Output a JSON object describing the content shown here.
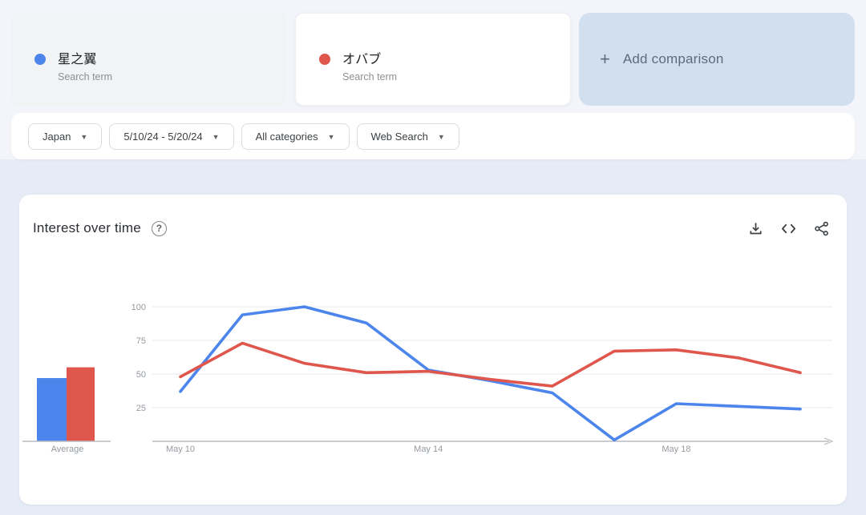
{
  "comparison_bar": {
    "terms": [
      {
        "label": "星之翼",
        "sublabel": "Search term",
        "color": "#4c85ec"
      },
      {
        "label": "オバブ",
        "sublabel": "Search term",
        "color": "#df564c"
      }
    ],
    "add_button": {
      "plus": "+",
      "label": "Add comparison"
    }
  },
  "filters": [
    {
      "label": "Japan"
    },
    {
      "label": "5/10/24 - 5/20/24"
    },
    {
      "label": "All categories"
    },
    {
      "label": "Web Search"
    }
  ],
  "chart_card": {
    "title": "Interest over time",
    "help_glyph": "?",
    "icons": [
      "download-icon",
      "embed-icon",
      "share-icon"
    ]
  },
  "chart_data": {
    "type": "line",
    "title": "Interest over time",
    "x": [
      "May 10",
      "May 11",
      "May 12",
      "May 13",
      "May 14",
      "May 15",
      "May 16",
      "May 17",
      "May 18",
      "May 19",
      "May 20"
    ],
    "x_tick_labels": [
      "May 10",
      "May 14",
      "May 18"
    ],
    "series": [
      {
        "name": "星之翼",
        "color": "#4c85ec",
        "values": [
          37,
          94,
          100,
          88,
          53,
          45,
          36,
          1,
          28,
          26,
          24
        ],
        "average": 47
      },
      {
        "name": "オバブ",
        "color": "#df564c",
        "values": [
          48,
          73,
          58,
          51,
          52,
          46,
          41,
          67,
          68,
          62,
          51
        ],
        "average": 55
      }
    ],
    "ylim": [
      0,
      100
    ],
    "y_ticks": [
      25,
      50,
      75,
      100
    ],
    "average_label": "Average",
    "grid": true,
    "legend_position": "none",
    "colors": {
      "gridline": "#e7e9ec",
      "axis": "#b9bcc1",
      "tick_text": "#949aa0"
    }
  }
}
